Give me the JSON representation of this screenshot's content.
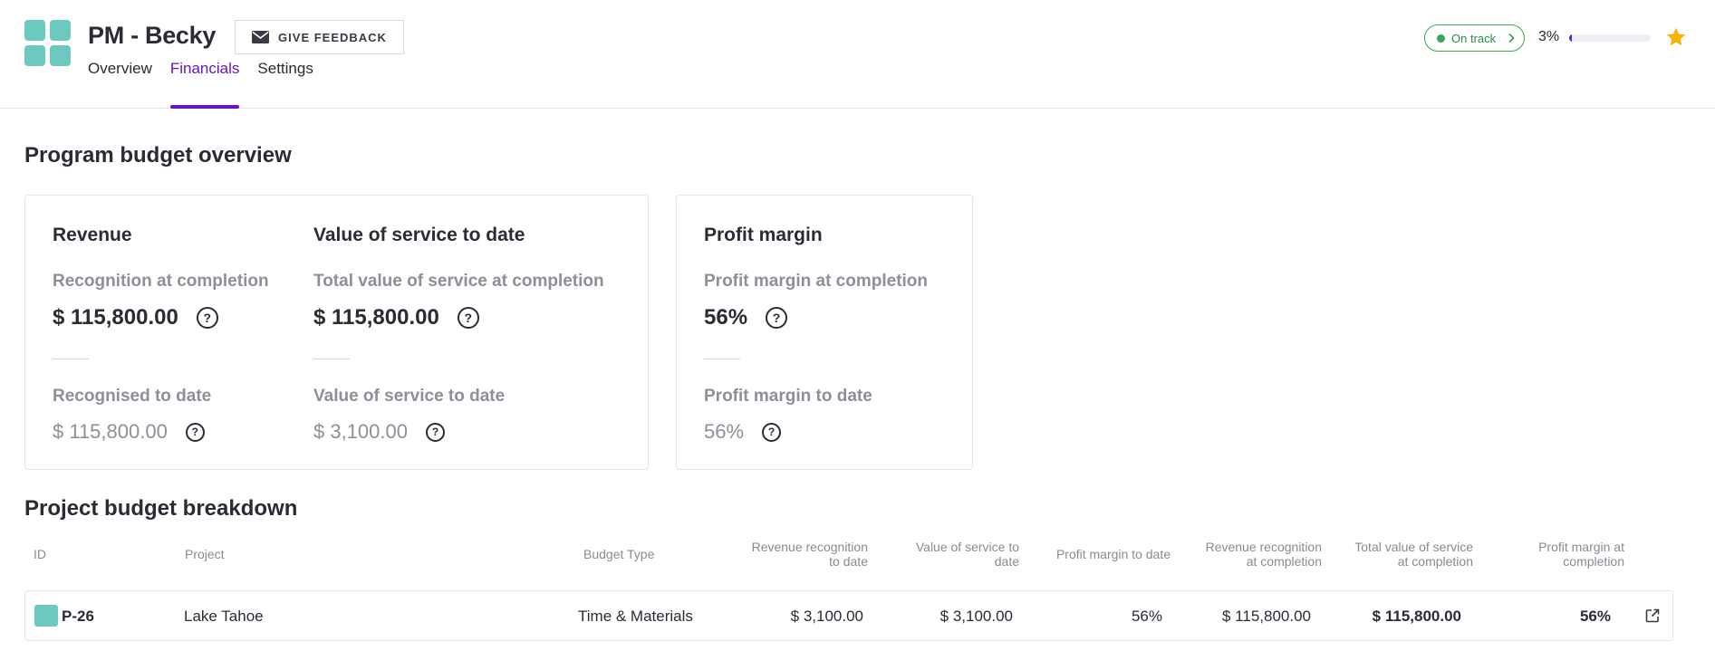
{
  "header": {
    "title": "PM - Becky",
    "feedback_label": "GIVE FEEDBACK",
    "tabs": [
      {
        "label": "Overview",
        "active": false
      },
      {
        "label": "Financials",
        "active": true
      },
      {
        "label": "Settings",
        "active": false
      }
    ],
    "status": {
      "label": "On track",
      "color": "#3aa556"
    },
    "progress": {
      "text": "3%",
      "value": 0.03,
      "color": "#5b1fd6"
    },
    "favorite": {
      "icon": "star-icon",
      "color": "#f5b400"
    }
  },
  "overview": {
    "title": "Program budget overview",
    "revenue": {
      "title": "Revenue",
      "completion_label": "Recognition at completion",
      "completion_value": "$ 115,800.00",
      "to_date_label": "Recognised to date",
      "to_date_value": "$ 115,800.00"
    },
    "service": {
      "title": "Value of service to date",
      "completion_label": "Total value of service at completion",
      "completion_value": "$ 115,800.00",
      "to_date_label": "Value of service to date",
      "to_date_value": "$ 3,100.00"
    },
    "margin": {
      "title": "Profit margin",
      "completion_label": "Profit margin at completion",
      "completion_value": "56%",
      "to_date_label": "Profit margin to date",
      "to_date_value": "56%"
    },
    "help_glyph": "?"
  },
  "breakdown": {
    "title": "Project budget breakdown",
    "columns": {
      "id": "ID",
      "project": "Project",
      "budget_type": "Budget Type",
      "rev_to_date_1": "Revenue recognition",
      "rev_to_date_2": "to date",
      "vos_to_date_1": "Value of service to",
      "vos_to_date_2": "date",
      "pm_to_date": "Profit margin to date",
      "rev_completion_1": "Revenue recognition",
      "rev_completion_2": "at completion",
      "vos_completion_1": "Total value of service",
      "vos_completion_2": "at completion",
      "pm_completion_1": "Profit margin at",
      "pm_completion_2": "completion"
    },
    "rows": [
      {
        "id": "P-26",
        "project": "Lake Tahoe",
        "budget_type": "Time & Materials",
        "rev_to_date": "$ 3,100.00",
        "vos_to_date": "$ 3,100.00",
        "pm_to_date": "56%",
        "rev_completion": "$ 115,800.00",
        "vos_completion": "$ 115,800.00",
        "pm_completion": "56%",
        "swatch_color": "#6cc9bf"
      }
    ]
  }
}
